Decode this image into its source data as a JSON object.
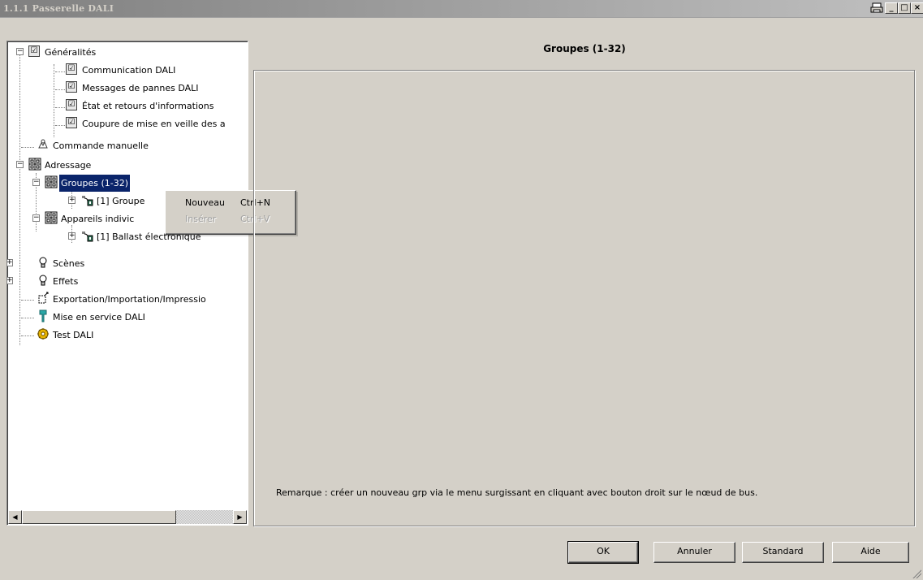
{
  "window": {
    "title": "1.1.1 Passerelle DALI",
    "controls": {
      "minimize": "_",
      "maximize": "□",
      "close": "×",
      "print_icon": "printer-icon"
    }
  },
  "tree": {
    "items": [
      {
        "label": "Généralités",
        "icon": "checklist-icon"
      },
      {
        "label": "Communication DALI",
        "icon": "checklist-icon"
      },
      {
        "label": "Messages de pannes DALI",
        "icon": "checklist-icon"
      },
      {
        "label": "État et retours d'informations",
        "icon": "checklist-icon"
      },
      {
        "label": "Coupure de mise en veille des a",
        "icon": "checklist-icon"
      },
      {
        "label": "Commande manuelle",
        "icon": "hand-icon"
      },
      {
        "label": "Adressage",
        "icon": "grid-icon"
      },
      {
        "label": "Groupes (1-32)",
        "icon": "grid-icon",
        "selected": true
      },
      {
        "label": "[1] Groupe",
        "icon": "lamp-device-icon"
      },
      {
        "label": "Appareils indivic",
        "icon": "grid-icon"
      },
      {
        "label": "[1] Ballast électronique",
        "icon": "lamp-device-icon"
      },
      {
        "label": "Scènes",
        "icon": "bulb-icon"
      },
      {
        "label": "Effets",
        "icon": "bulb-icon"
      },
      {
        "label": "Exportation/Importation/Impressio",
        "icon": "export-icon"
      },
      {
        "label": "Mise en service DALI",
        "icon": "wrench-icon"
      },
      {
        "label": "Test DALI",
        "icon": "gear-icon"
      }
    ]
  },
  "context_menu": {
    "items": [
      {
        "label": "Nouveau",
        "shortcut": "Ctrl+N",
        "enabled": true
      },
      {
        "label": "Insérer",
        "shortcut": "Ctrl+V",
        "enabled": false
      }
    ]
  },
  "main": {
    "title": "Groupes (1-32)",
    "remark": "Remarque : créer un nouveau grp via le menu surgissant en cliquant avec  bouton droit sur le nœud de bus."
  },
  "buttons": {
    "ok": "OK",
    "cancel": "Annuler",
    "standard": "Standard",
    "help": "Aide"
  }
}
